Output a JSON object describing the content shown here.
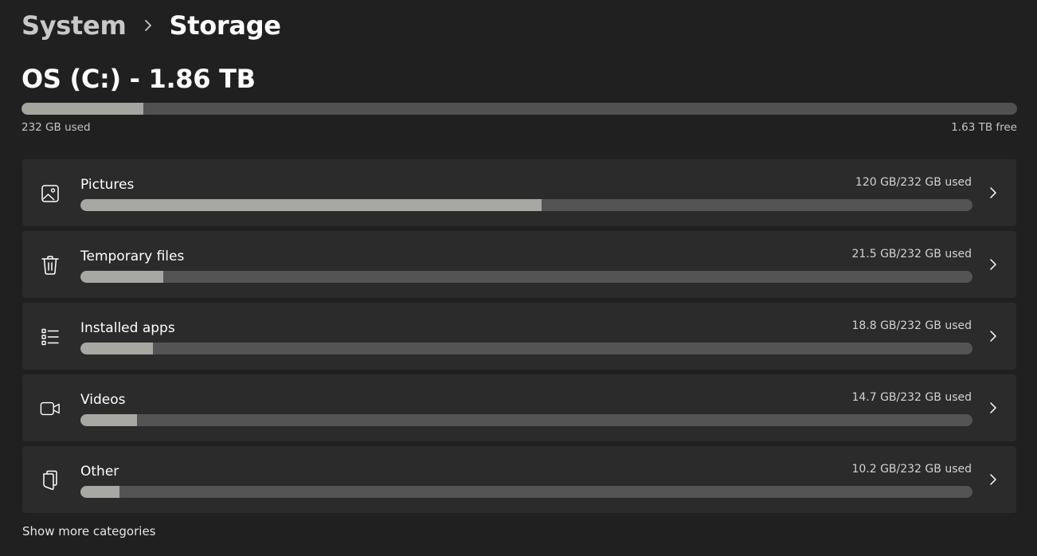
{
  "breadcrumb": {
    "parent": "System",
    "separator_icon": "chevron-right-icon",
    "current": "Storage"
  },
  "drive": {
    "title": "OS (C:) - 1.86 TB",
    "used_label": "232 GB used",
    "free_label": "1.63 TB free",
    "used_fraction": 0.122
  },
  "categories": [
    {
      "name": "Pictures",
      "icon": "image-icon",
      "usage": "120 GB/232 GB used",
      "fraction": 0.517
    },
    {
      "name": "Temporary files",
      "icon": "trash-icon",
      "usage": "21.5 GB/232 GB used",
      "fraction": 0.093
    },
    {
      "name": "Installed apps",
      "icon": "list-icon",
      "usage": "18.8 GB/232 GB used",
      "fraction": 0.081
    },
    {
      "name": "Videos",
      "icon": "video-camera-icon",
      "usage": "14.7 GB/232 GB used",
      "fraction": 0.063
    },
    {
      "name": "Other",
      "icon": "documents-icon",
      "usage": "10.2 GB/232 GB used",
      "fraction": 0.044
    }
  ],
  "show_more": "Show more categories",
  "colors": {
    "background": "#202020",
    "card": "#2b2b2b",
    "bar_track": "#545454",
    "bar_fill": "#a8a8a3"
  }
}
